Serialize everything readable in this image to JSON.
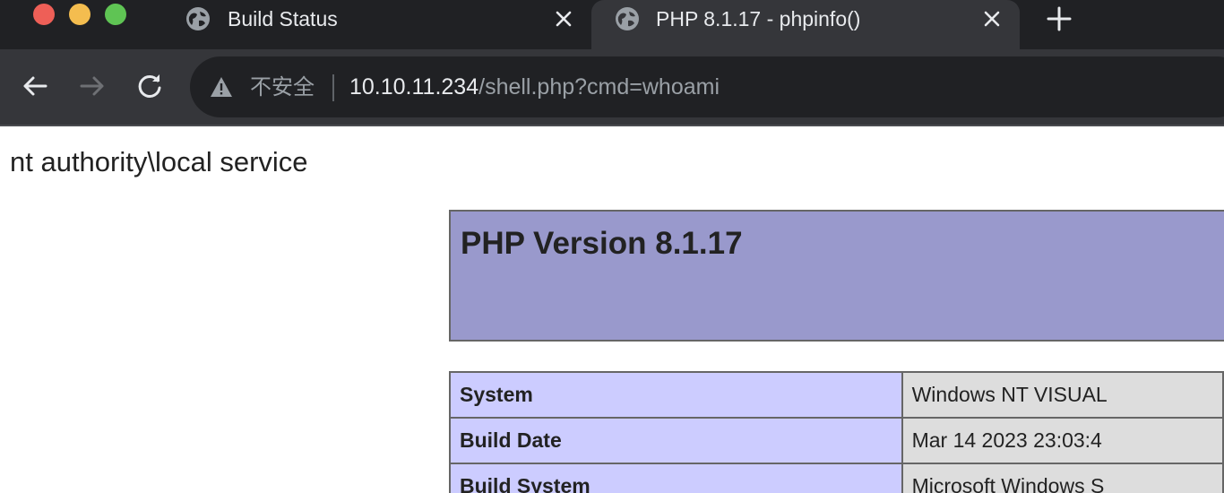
{
  "browser": {
    "tabs": [
      {
        "title": "Build Status",
        "icon": "globe-icon",
        "active": false
      },
      {
        "title": "PHP 8.1.17 - phpinfo()",
        "icon": "globe-icon",
        "active": true
      }
    ],
    "address_bar": {
      "security_label": "不安全",
      "url_host": "10.10.11.234",
      "url_path": "/shell.php?cmd=whoami"
    }
  },
  "page": {
    "command_output": "nt authority\\local service",
    "phpinfo": {
      "version_title": "PHP Version 8.1.17",
      "rows": [
        {
          "key": "System",
          "value": "Windows NT VISUAL"
        },
        {
          "key": "Build Date",
          "value": "Mar 14 2023 23:03:4"
        },
        {
          "key": "Build System",
          "value": "Microsoft Windows S"
        }
      ]
    }
  },
  "colors": {
    "chrome_dark": "#202124",
    "chrome_toolbar": "#35363a",
    "php_header": "#9999cc",
    "php_key_cell": "#ccccff",
    "php_value_cell": "#dddddd"
  }
}
